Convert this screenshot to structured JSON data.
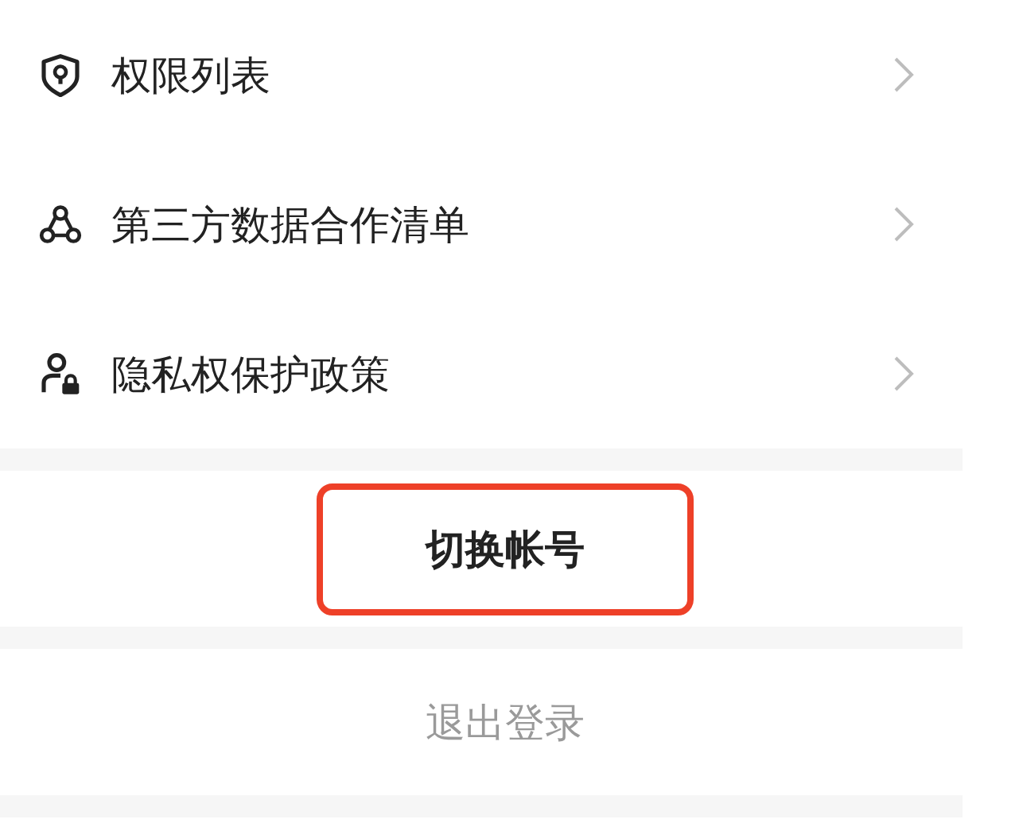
{
  "menu": [
    {
      "kind": "shield",
      "label": "权限列表"
    },
    {
      "kind": "triad",
      "label": "第三方数据合作清单"
    },
    {
      "kind": "user-lock",
      "label": "隐私权保护政策"
    }
  ],
  "actions": [
    {
      "label": "切换帐号",
      "kind": "primary",
      "highlighted": true
    },
    {
      "label": "退出登录",
      "kind": "muted",
      "highlighted": false
    }
  ]
}
